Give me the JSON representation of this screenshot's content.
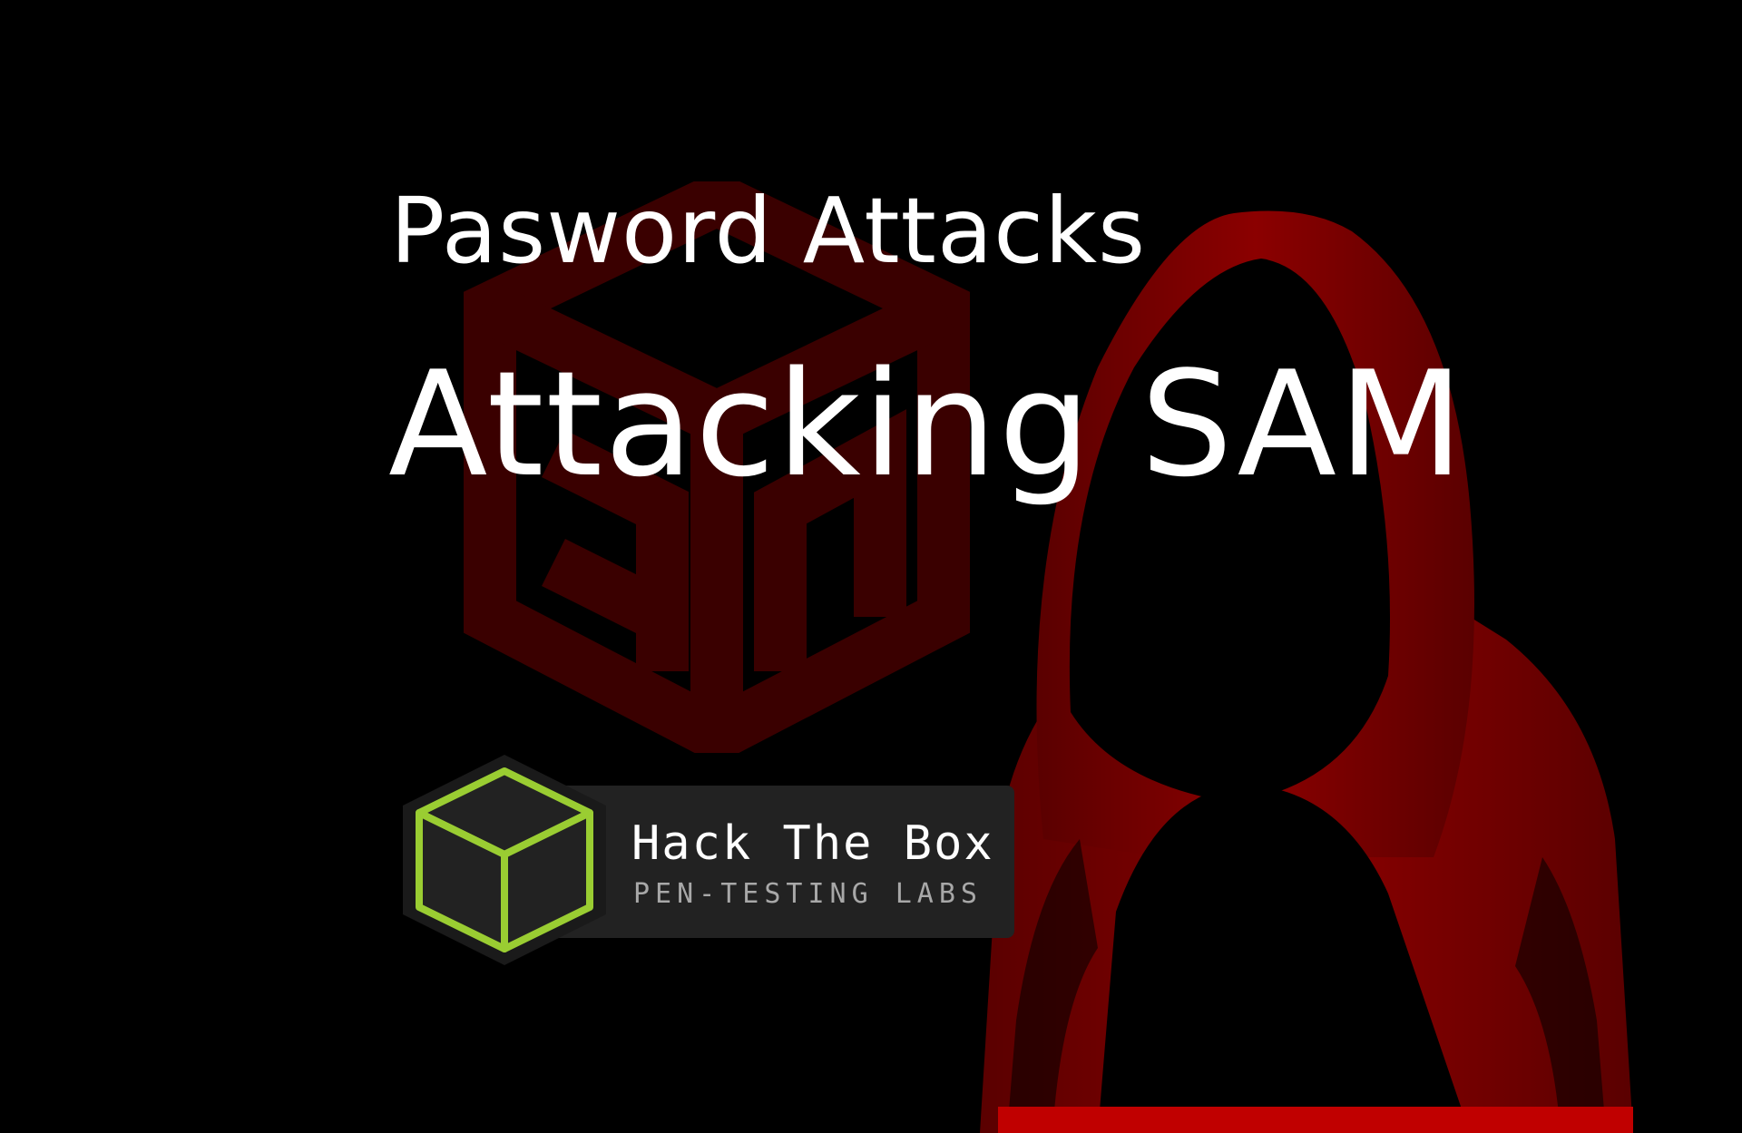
{
  "slide": {
    "subtitle": "Pasword Attacks",
    "title": "Attacking SAM"
  },
  "badge": {
    "name": "Hack The Box",
    "tagline": "PEN-TESTING LABS",
    "cube_color": "#9acd32"
  },
  "colors": {
    "background": "#000000",
    "accent_red": "#8b0000",
    "logo_red": "#3a0000"
  },
  "icons": [
    "background-cube-logo-icon",
    "hooded-figure-icon",
    "hack-the-box-cube-icon"
  ]
}
